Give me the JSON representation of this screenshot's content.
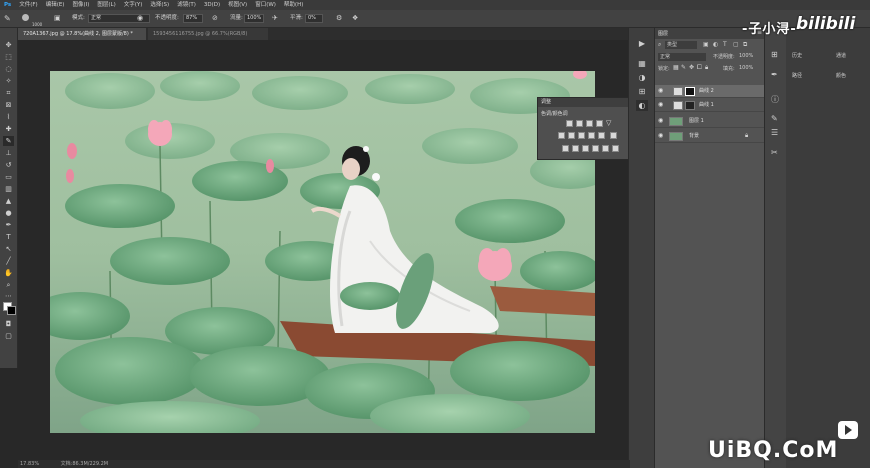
{
  "menubar": {
    "items": [
      "文件(F)",
      "编辑(E)",
      "图像(I)",
      "图层(L)",
      "文字(Y)",
      "选择(S)",
      "滤镜(T)",
      "3D(D)",
      "视图(V)",
      "窗口(W)",
      "帮助(H)"
    ]
  },
  "options": {
    "brush_size": "1000",
    "mode_label": "模式:",
    "mode_value": "正常",
    "opacity_label": "不透明度:",
    "opacity_value": "87%",
    "flow_label": "流量:",
    "flow_value": "100%",
    "smooth_label": "平滑:",
    "smooth_value": "0%"
  },
  "tabs": [
    {
      "label": "720A1367.jpg @ 17.8%(曲线 2, 图层蒙版/8) *"
    },
    {
      "label": "1593456116755.jpg @ 66.7%(RGB/8)"
    }
  ],
  "adjustments": {
    "title": "调整",
    "subtitle": "色调/颜色调"
  },
  "layers": {
    "tab": "图层",
    "kind_label": "类型",
    "blend": "正常",
    "opacity_label": "不透明度:",
    "opacity_value": "100%",
    "lock_label": "锁定:",
    "fill_label": "填充:",
    "fill_value": "100%",
    "rows": [
      {
        "name": "曲线 2"
      },
      {
        "name": "曲线 1"
      },
      {
        "name": "图层 1"
      },
      {
        "name": "背景"
      }
    ]
  },
  "farright": {
    "item1": "历史",
    "item2": "路径",
    "item3": "通道",
    "item4": "颜色"
  },
  "status": {
    "zoom": "17.83%",
    "doc": "文档:86.3M/229.2M"
  },
  "watermarks": {
    "channel": "-子小浔-",
    "bili": "bilibili",
    "site": "UiBQ.CoM"
  },
  "colors": {
    "foreground": "#ffffff",
    "background": "#000000"
  }
}
